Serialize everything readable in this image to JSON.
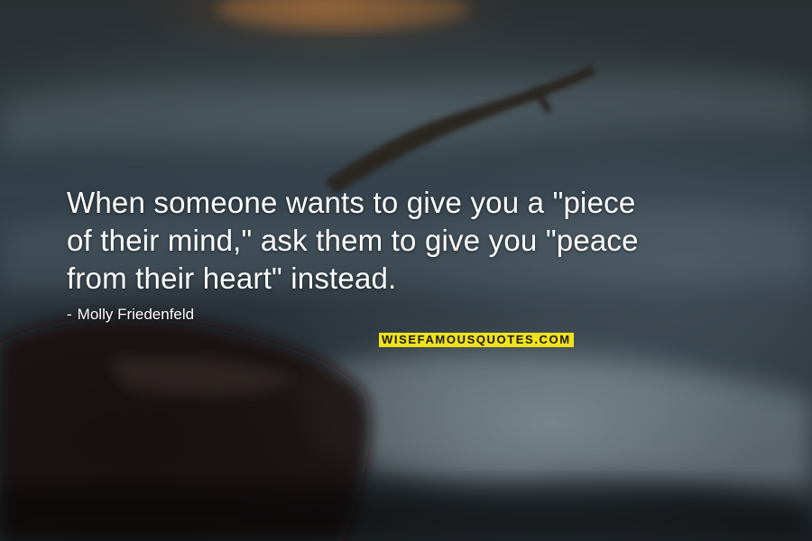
{
  "quote": {
    "lines": [
      "When someone wants to give you a \"piece",
      "of their mind,\" ask them to give you \"peace",
      "from their heart\" instead."
    ],
    "author_dash": "-",
    "author": "Molly Friedenfeld"
  },
  "watermark": {
    "text": "WISEFAMOUSQUOTES.COM"
  },
  "colors": {
    "text": "#ffffff",
    "watermark_bg": "#f2e21a",
    "watermark_text": "#1a1a1a"
  }
}
